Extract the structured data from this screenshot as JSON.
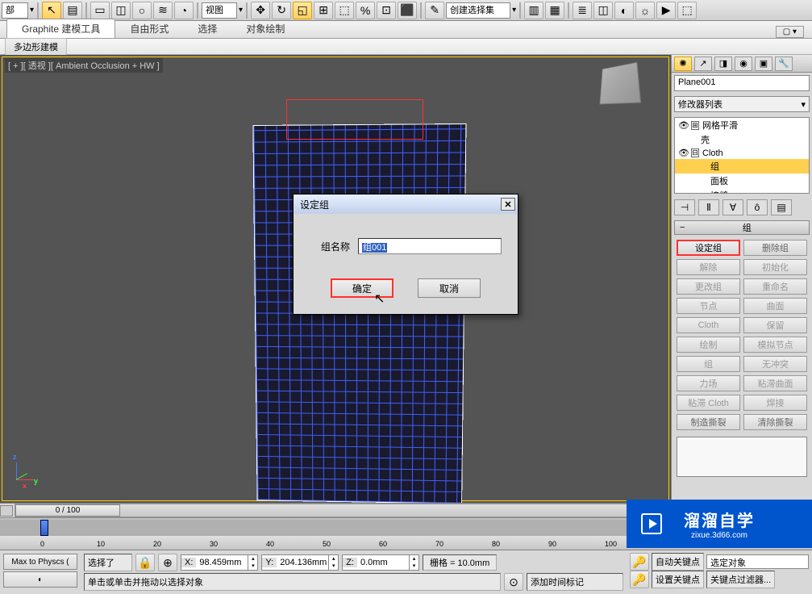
{
  "toolbar": {
    "dropdown1": "部",
    "dropdown_view": "视图",
    "dropdown_sel": "创建选择集"
  },
  "ribbon": {
    "tabs": [
      "Graphite 建模工具",
      "自由形式",
      "选择",
      "对象绘制"
    ],
    "sub": "多边形建模"
  },
  "viewport": {
    "label": "[ + ][ 透视 ][ Ambient Occlusion + HW ]"
  },
  "panel": {
    "object_name": "Plane001",
    "modifier_list_label": "修改器列表",
    "stack": [
      {
        "icon": "👁",
        "expand": "⊞",
        "label": "网格平滑",
        "indent": 0
      },
      {
        "icon": "",
        "expand": "",
        "label": "壳",
        "indent": 1
      },
      {
        "icon": "👁",
        "expand": "⊟",
        "label": "Cloth",
        "indent": 0
      },
      {
        "icon": "",
        "expand": "",
        "label": "组",
        "indent": 2,
        "selected": true
      },
      {
        "icon": "",
        "expand": "",
        "label": "面板",
        "indent": 2
      },
      {
        "icon": "",
        "expand": "",
        "label": "接缝",
        "indent": 2
      }
    ],
    "rollout_title": "组",
    "buttons": {
      "set_group": "设定组",
      "del_group": "删除组",
      "unassign": "解除",
      "init": "初始化",
      "change_group": "更改组",
      "rename": "重命名",
      "node": "节点",
      "surface": "曲面",
      "cloth": "Cloth",
      "keep": "保留",
      "draw": "绘制",
      "sim_node": "模拟节点",
      "group": "组",
      "noconflict": "无冲突",
      "force": "力场",
      "sticky_surf": "粘滞曲面",
      "sticky_cloth": "粘滞 Cloth",
      "weld": "焊接",
      "make_tear": "制造撕裂",
      "clear_tear": "清除撕裂"
    }
  },
  "dialog": {
    "title": "设定组",
    "label": "组名称",
    "value": "组001",
    "ok": "确定",
    "cancel": "取消"
  },
  "timeline": {
    "position": "0 / 100",
    "ticks": [
      0,
      10,
      20,
      30,
      40,
      50,
      60,
      70,
      80,
      90,
      100
    ]
  },
  "status": {
    "maxscript": "Max to Physcs (",
    "selected": "选择了",
    "x": "98.459mm",
    "y": "204.136mm",
    "z": "0.0mm",
    "grid": "栅格 = 10.0mm",
    "prompt": "单击或单击并拖动以选择对象",
    "add_time": "添加时间标记",
    "autokey": "自动关键点",
    "selobj": "选定对象",
    "setkey": "设置关键点",
    "keyfilter": "关键点过滤器..."
  },
  "watermark": {
    "text": "溜溜自学",
    "url": "zixue.3d66.com"
  }
}
